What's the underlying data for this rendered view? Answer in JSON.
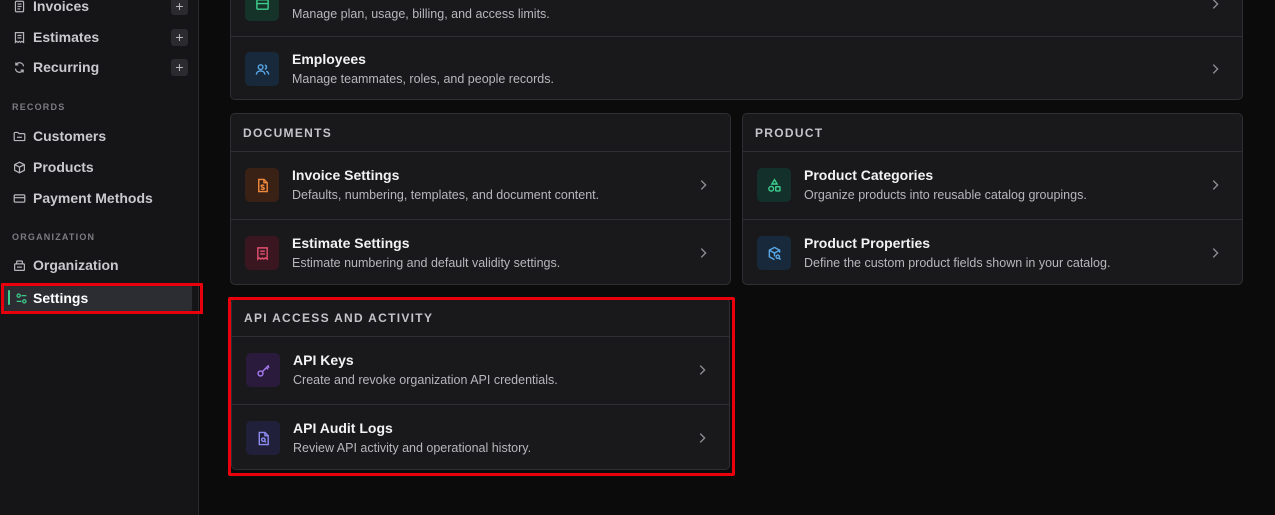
{
  "sidebar": {
    "items": [
      {
        "label": "Invoices",
        "icon": "invoice-icon",
        "has_add": true
      },
      {
        "label": "Estimates",
        "icon": "estimate-icon",
        "has_add": true
      },
      {
        "label": "Recurring",
        "icon": "recurring-icon",
        "has_add": true
      }
    ],
    "add_symbol": "+",
    "records_label": "RECORDS",
    "records": [
      {
        "label": "Customers",
        "icon": "folder-icon"
      },
      {
        "label": "Products",
        "icon": "box-icon"
      },
      {
        "label": "Payment Methods",
        "icon": "card-icon"
      }
    ],
    "organization_label": "ORGANIZATION",
    "organization": [
      {
        "label": "Organization",
        "icon": "building-icon"
      },
      {
        "label": "Settings",
        "icon": "sliders-icon",
        "active": true
      }
    ]
  },
  "top_panel": {
    "rows": [
      {
        "title": "",
        "desc": "Manage plan, usage, billing, and access limits.",
        "icon": "plan-icon"
      },
      {
        "title": "Employees",
        "desc": "Manage teammates, roles, and people records.",
        "icon": "users-icon"
      }
    ]
  },
  "documents": {
    "header": "DOCUMENTS",
    "rows": [
      {
        "title": "Invoice Settings",
        "desc": "Defaults, numbering, templates, and document content.",
        "icon": "file-dollar-icon"
      },
      {
        "title": "Estimate Settings",
        "desc": "Estimate numbering and default validity settings.",
        "icon": "receipt-icon"
      }
    ]
  },
  "product": {
    "header": "PRODUCT",
    "rows": [
      {
        "title": "Product Categories",
        "desc": "Organize products into reusable catalog groupings.",
        "icon": "shapes-icon"
      },
      {
        "title": "Product Properties",
        "desc": "Define the custom product fields shown in your catalog.",
        "icon": "package-search-icon"
      }
    ]
  },
  "api": {
    "header": "API ACCESS AND ACTIVITY",
    "rows": [
      {
        "title": "API Keys",
        "desc": "Create and revoke organization API credentials.",
        "icon": "key-icon"
      },
      {
        "title": "API Audit Logs",
        "desc": "Review API activity and operational history.",
        "icon": "file-search-icon"
      }
    ]
  },
  "colors": {
    "accent_green": "#3ecf8e",
    "highlight_red": "#e8000c",
    "icon_orange": "#f08a3c",
    "icon_pink": "#e0506d",
    "icon_teal": "#3ecf8e",
    "icon_blue": "#5aa7e6",
    "icon_purple": "#a77bf0",
    "icon_indigo": "#8c8cf0"
  }
}
